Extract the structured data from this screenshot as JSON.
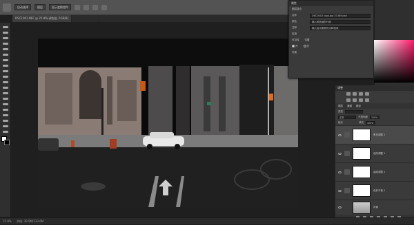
{
  "options_bar": {
    "items": [
      "自动选择",
      "图层",
      "显示变换控件"
    ]
  },
  "doc_tabs": [
    {
      "label": "DSC1001.NEF @ 25.8%(调色组, RGB/8)",
      "active": true
    },
    {
      "label": "",
      "active": false
    }
  ],
  "status": {
    "zoom": "25.8%",
    "doc": "文档: 39.9M/133.6M"
  },
  "properties": {
    "title": "属性",
    "section": "图层复合",
    "name_label": "名称",
    "name_value": "DSC0002 logo.jpg 33.8M.psd",
    "row2_label": "颜色",
    "row2_value": "输入颜色值的代码",
    "row3_label": "注释",
    "row3_value": "输入复合图层的注释信息",
    "group_label": "应用",
    "opt1": "可见性",
    "opt2": "位置",
    "opt3": "外观",
    "radio1": "开",
    "radio2": "关"
  },
  "panel": {
    "title": "调整",
    "layers_tabs": [
      "图层",
      "通道",
      "路径"
    ],
    "kind_label": "类型",
    "blend": "正常",
    "opacity_label": "不透明度",
    "opacity": "100%",
    "lock_label": "锁定",
    "fill_label": "填充",
    "fill": "100%",
    "layers": [
      {
        "name": "黑白调整 1",
        "selected": true,
        "type": "adjust"
      },
      {
        "name": "色阶调整 1",
        "selected": false,
        "type": "adjust"
      },
      {
        "name": "曲线调整 1",
        "selected": false,
        "type": "adjust"
      },
      {
        "name": "色彩平衡 1",
        "selected": false,
        "type": "adjust"
      },
      {
        "name": "背景",
        "selected": false,
        "type": "photo"
      }
    ]
  },
  "canvas": {
    "description_colors": {
      "sky": "#111111",
      "building": "#8a7b74",
      "street": "#2a2a2a"
    }
  }
}
